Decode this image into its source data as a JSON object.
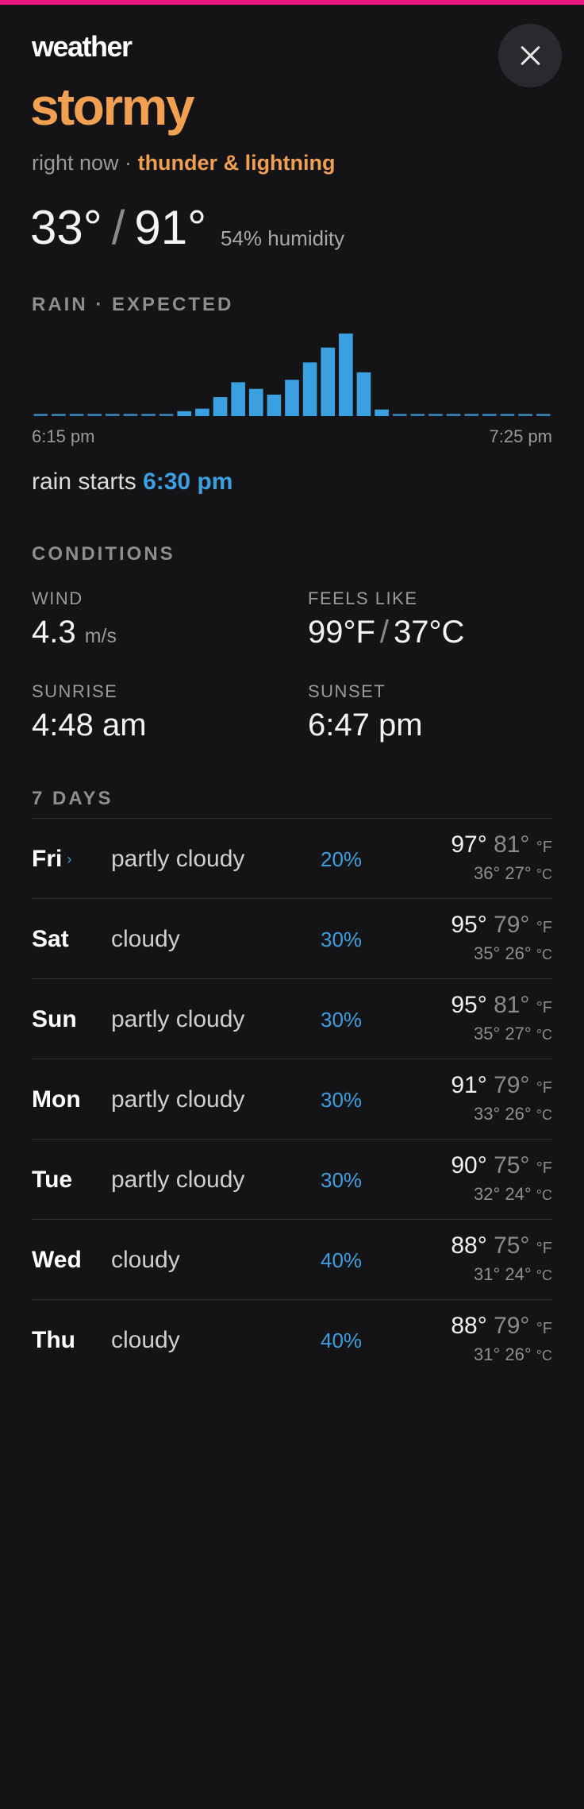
{
  "colors": {
    "accent_orange": "#f0a050",
    "accent_blue": "#3aa0e0",
    "top_bar": "#e8177f",
    "background": "#141416"
  },
  "header": {
    "app_title": "weather",
    "close_icon": "close-icon"
  },
  "current": {
    "condition": "stormy",
    "now_prefix": "right now ·",
    "now_desc": "thunder & lightning",
    "temp_c": "33°",
    "temp_sep": "/",
    "temp_f": "91°",
    "humidity": "54% humidity"
  },
  "rain": {
    "title": "RAIN · EXPECTED",
    "start_label": "6:15 pm",
    "end_label": "7:25 pm",
    "bars": [
      0,
      0,
      0,
      0,
      0,
      0,
      0,
      0,
      0.06,
      0.09,
      0.23,
      0.41,
      0.33,
      0.26,
      0.44,
      0.65,
      0.83,
      1.0,
      0.53,
      0.08,
      0,
      0,
      0,
      0,
      0,
      0,
      0,
      0,
      0
    ],
    "starts_prefix": "rain starts",
    "starts_time": "6:30 pm"
  },
  "conditions": {
    "title": "CONDITIONS",
    "wind": {
      "label": "WIND",
      "value": "4.3",
      "unit": "m/s"
    },
    "feels": {
      "label": "FEELS LIKE",
      "f": "99°F",
      "sep": "/",
      "c": "37°C"
    },
    "sunrise": {
      "label": "SUNRISE",
      "value": "4:48 am"
    },
    "sunset": {
      "label": "SUNSET",
      "value": "6:47 pm"
    }
  },
  "forecast": {
    "title": "7 DAYS",
    "unit_f": "°F",
    "unit_c": "°C",
    "days": [
      {
        "day": "Fri",
        "chevron": "›",
        "cond": "partly cloudy",
        "pop": "20%",
        "hi_f": "97°",
        "lo_f": "81°",
        "hi_c": "36°",
        "lo_c": "27°"
      },
      {
        "day": "Sat",
        "cond": "cloudy",
        "pop": "30%",
        "hi_f": "95°",
        "lo_f": "79°",
        "hi_c": "35°",
        "lo_c": "26°"
      },
      {
        "day": "Sun",
        "cond": "partly cloudy",
        "pop": "30%",
        "hi_f": "95°",
        "lo_f": "81°",
        "hi_c": "35°",
        "lo_c": "27°"
      },
      {
        "day": "Mon",
        "cond": "partly cloudy",
        "pop": "30%",
        "hi_f": "91°",
        "lo_f": "79°",
        "hi_c": "33°",
        "lo_c": "26°"
      },
      {
        "day": "Tue",
        "cond": "partly cloudy",
        "pop": "30%",
        "hi_f": "90°",
        "lo_f": "75°",
        "hi_c": "32°",
        "lo_c": "24°"
      },
      {
        "day": "Wed",
        "cond": "cloudy",
        "pop": "40%",
        "hi_f": "88°",
        "lo_f": "75°",
        "hi_c": "31°",
        "lo_c": "24°"
      },
      {
        "day": "Thu",
        "cond": "cloudy",
        "pop": "40%",
        "hi_f": "88°",
        "lo_f": "79°",
        "hi_c": "31°",
        "lo_c": "26°"
      }
    ]
  }
}
